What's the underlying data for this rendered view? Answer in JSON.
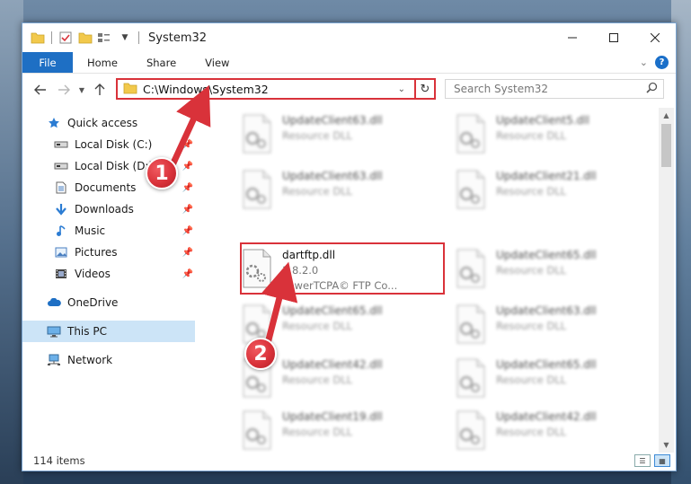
{
  "window": {
    "title": "System32"
  },
  "ribbon": {
    "tabs": [
      "File",
      "Home",
      "Share",
      "View"
    ],
    "help": "?"
  },
  "address": {
    "path": "C:\\Windows\\System32",
    "search_placeholder": "Search System32"
  },
  "nav": {
    "items": [
      {
        "label": "Quick access",
        "icon": "star-icon"
      },
      {
        "label": "Local Disk (C:)",
        "icon": "drive-icon"
      },
      {
        "label": "Local Disk (D:)",
        "icon": "drive-icon"
      },
      {
        "label": "Documents",
        "icon": "documents-icon"
      },
      {
        "label": "Downloads",
        "icon": "download-arrow-icon"
      },
      {
        "label": "Music",
        "icon": "music-note-icon"
      },
      {
        "label": "Pictures",
        "icon": "pictures-icon"
      },
      {
        "label": "Videos",
        "icon": "film-icon"
      },
      {
        "label": "OneDrive",
        "icon": "cloud-icon"
      },
      {
        "label": "This PC",
        "icon": "monitor-icon"
      },
      {
        "label": "Network",
        "icon": "network-icon"
      }
    ]
  },
  "files": [
    {
      "name": "UpdateClient63.dll",
      "desc": "Resource DLL"
    },
    {
      "name": "UpdateClient5.dll",
      "desc": "Resource DLL"
    },
    {
      "name": "UpdateClient63.dll",
      "desc": "Resource DLL"
    },
    {
      "name": "UpdateClient21.dll",
      "desc": "Resource DLL"
    },
    {
      "name": "dartftp.dll",
      "version": "1.8.2.0",
      "desc": "PowerTCPA© FTP Co..."
    },
    {
      "name": "UpdateClient65.dll",
      "desc": "Resource DLL"
    },
    {
      "name": "UpdateClient65.dll",
      "desc": "Resource DLL"
    },
    {
      "name": "UpdateClient63.dll",
      "desc": "Resource DLL"
    },
    {
      "name": "UpdateClient42.dll",
      "desc": "Resource DLL"
    },
    {
      "name": "UpdateClient65.dll",
      "desc": "Resource DLL"
    },
    {
      "name": "UpdateClient19.dll",
      "desc": "Resource DLL"
    },
    {
      "name": "UpdateClient42.dll",
      "desc": "Resource DLL"
    }
  ],
  "status": {
    "count": "114 items"
  },
  "callouts": [
    "1",
    "2"
  ],
  "colors": {
    "accent": "#1e6fc4",
    "highlight": "#d9323a",
    "selected": "#cce4f7"
  }
}
